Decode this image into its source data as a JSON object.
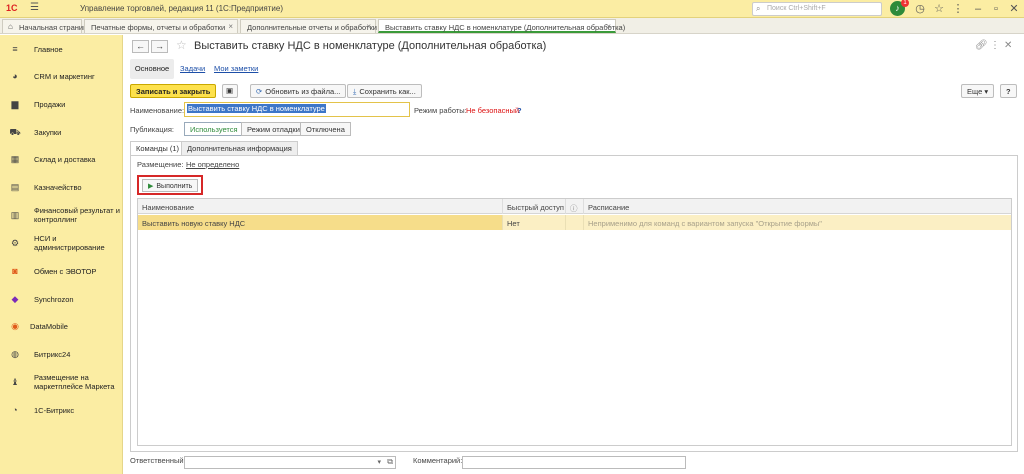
{
  "app": {
    "logo": "1С",
    "title": "Управление торговлей, редакция 11  (1С:Предприятие)",
    "search_placeholder": "Поиск Ctrl+Shift+F",
    "notifications_count": "1"
  },
  "tabs": [
    {
      "label": "Начальная страница"
    },
    {
      "label": "Печатные формы, отчеты и обработки"
    },
    {
      "label": "Дополнительные отчеты и обработки"
    },
    {
      "label": "Выставить ставку НДС в номенклатуре (Дополнительная обработка)"
    }
  ],
  "sidebar": {
    "items": [
      {
        "label": "Главное",
        "icon": "menu-icon"
      },
      {
        "label": "CRM и маркетинг",
        "icon": "pie-icon"
      },
      {
        "label": "Продажи",
        "icon": "bag-icon"
      },
      {
        "label": "Закупки",
        "icon": "cart-icon"
      },
      {
        "label": "Склад и доставка",
        "icon": "warehouse-icon"
      },
      {
        "label": "Казначейство",
        "icon": "coins-icon"
      },
      {
        "label": "Финансовый результат и контроллинг",
        "icon": "chart-icon"
      },
      {
        "label": "НСИ и администрирование",
        "icon": "gear-icon"
      },
      {
        "label": "Обмен с ЭВОТОР",
        "icon": "evotor-icon"
      },
      {
        "label": "Synchrozon",
        "icon": "synchrozon-icon"
      },
      {
        "label": "DataMobile",
        "icon": "datamobile-icon"
      },
      {
        "label": "Битрикс24",
        "icon": "bitrix24-icon"
      },
      {
        "label": "Размещение на маркетплейсе Маркета",
        "icon": "market-icon"
      },
      {
        "label": "1С-Битрикс",
        "icon": "bitrix-icon"
      }
    ]
  },
  "form": {
    "title": "Выставить ставку НДС в номенклатуре (Дополнительная обработка)",
    "section_tabs": [
      "Основное",
      "Задачи",
      "Мои заметки"
    ],
    "toolbar": {
      "save_close": "Записать и закрыть",
      "update_from_file": "Обновить из файла...",
      "save_as": "Сохранить как...",
      "more": "Еще",
      "help": "?"
    },
    "name_label": "Наименование:",
    "name_value": "Выставить ставку НДС в номенклатуре",
    "mode_label": "Режим работы:",
    "mode_value": "Не безопасный",
    "mode_help": "?",
    "publication_label": "Публикация:",
    "publication_options": [
      "Используется",
      "Режим отладки",
      "Отключена"
    ],
    "inner_tabs": [
      "Команды (1)",
      "Дополнительная информация"
    ],
    "placement_label": "Размещение:",
    "placement_value": "Не определено",
    "execute_button": "Выполнить",
    "commands_table": {
      "columns": [
        "Наименование",
        "Быстрый доступ",
        "Расписание"
      ],
      "rows": [
        {
          "name": "Выставить новую ставку НДС",
          "quick_access": "Нет",
          "schedule": "Неприменимо для команд с вариантом запуска \"Открытие формы\""
        }
      ]
    },
    "footer": {
      "responsible_label": "Ответственный:",
      "comment_label": "Комментарий:"
    }
  }
}
